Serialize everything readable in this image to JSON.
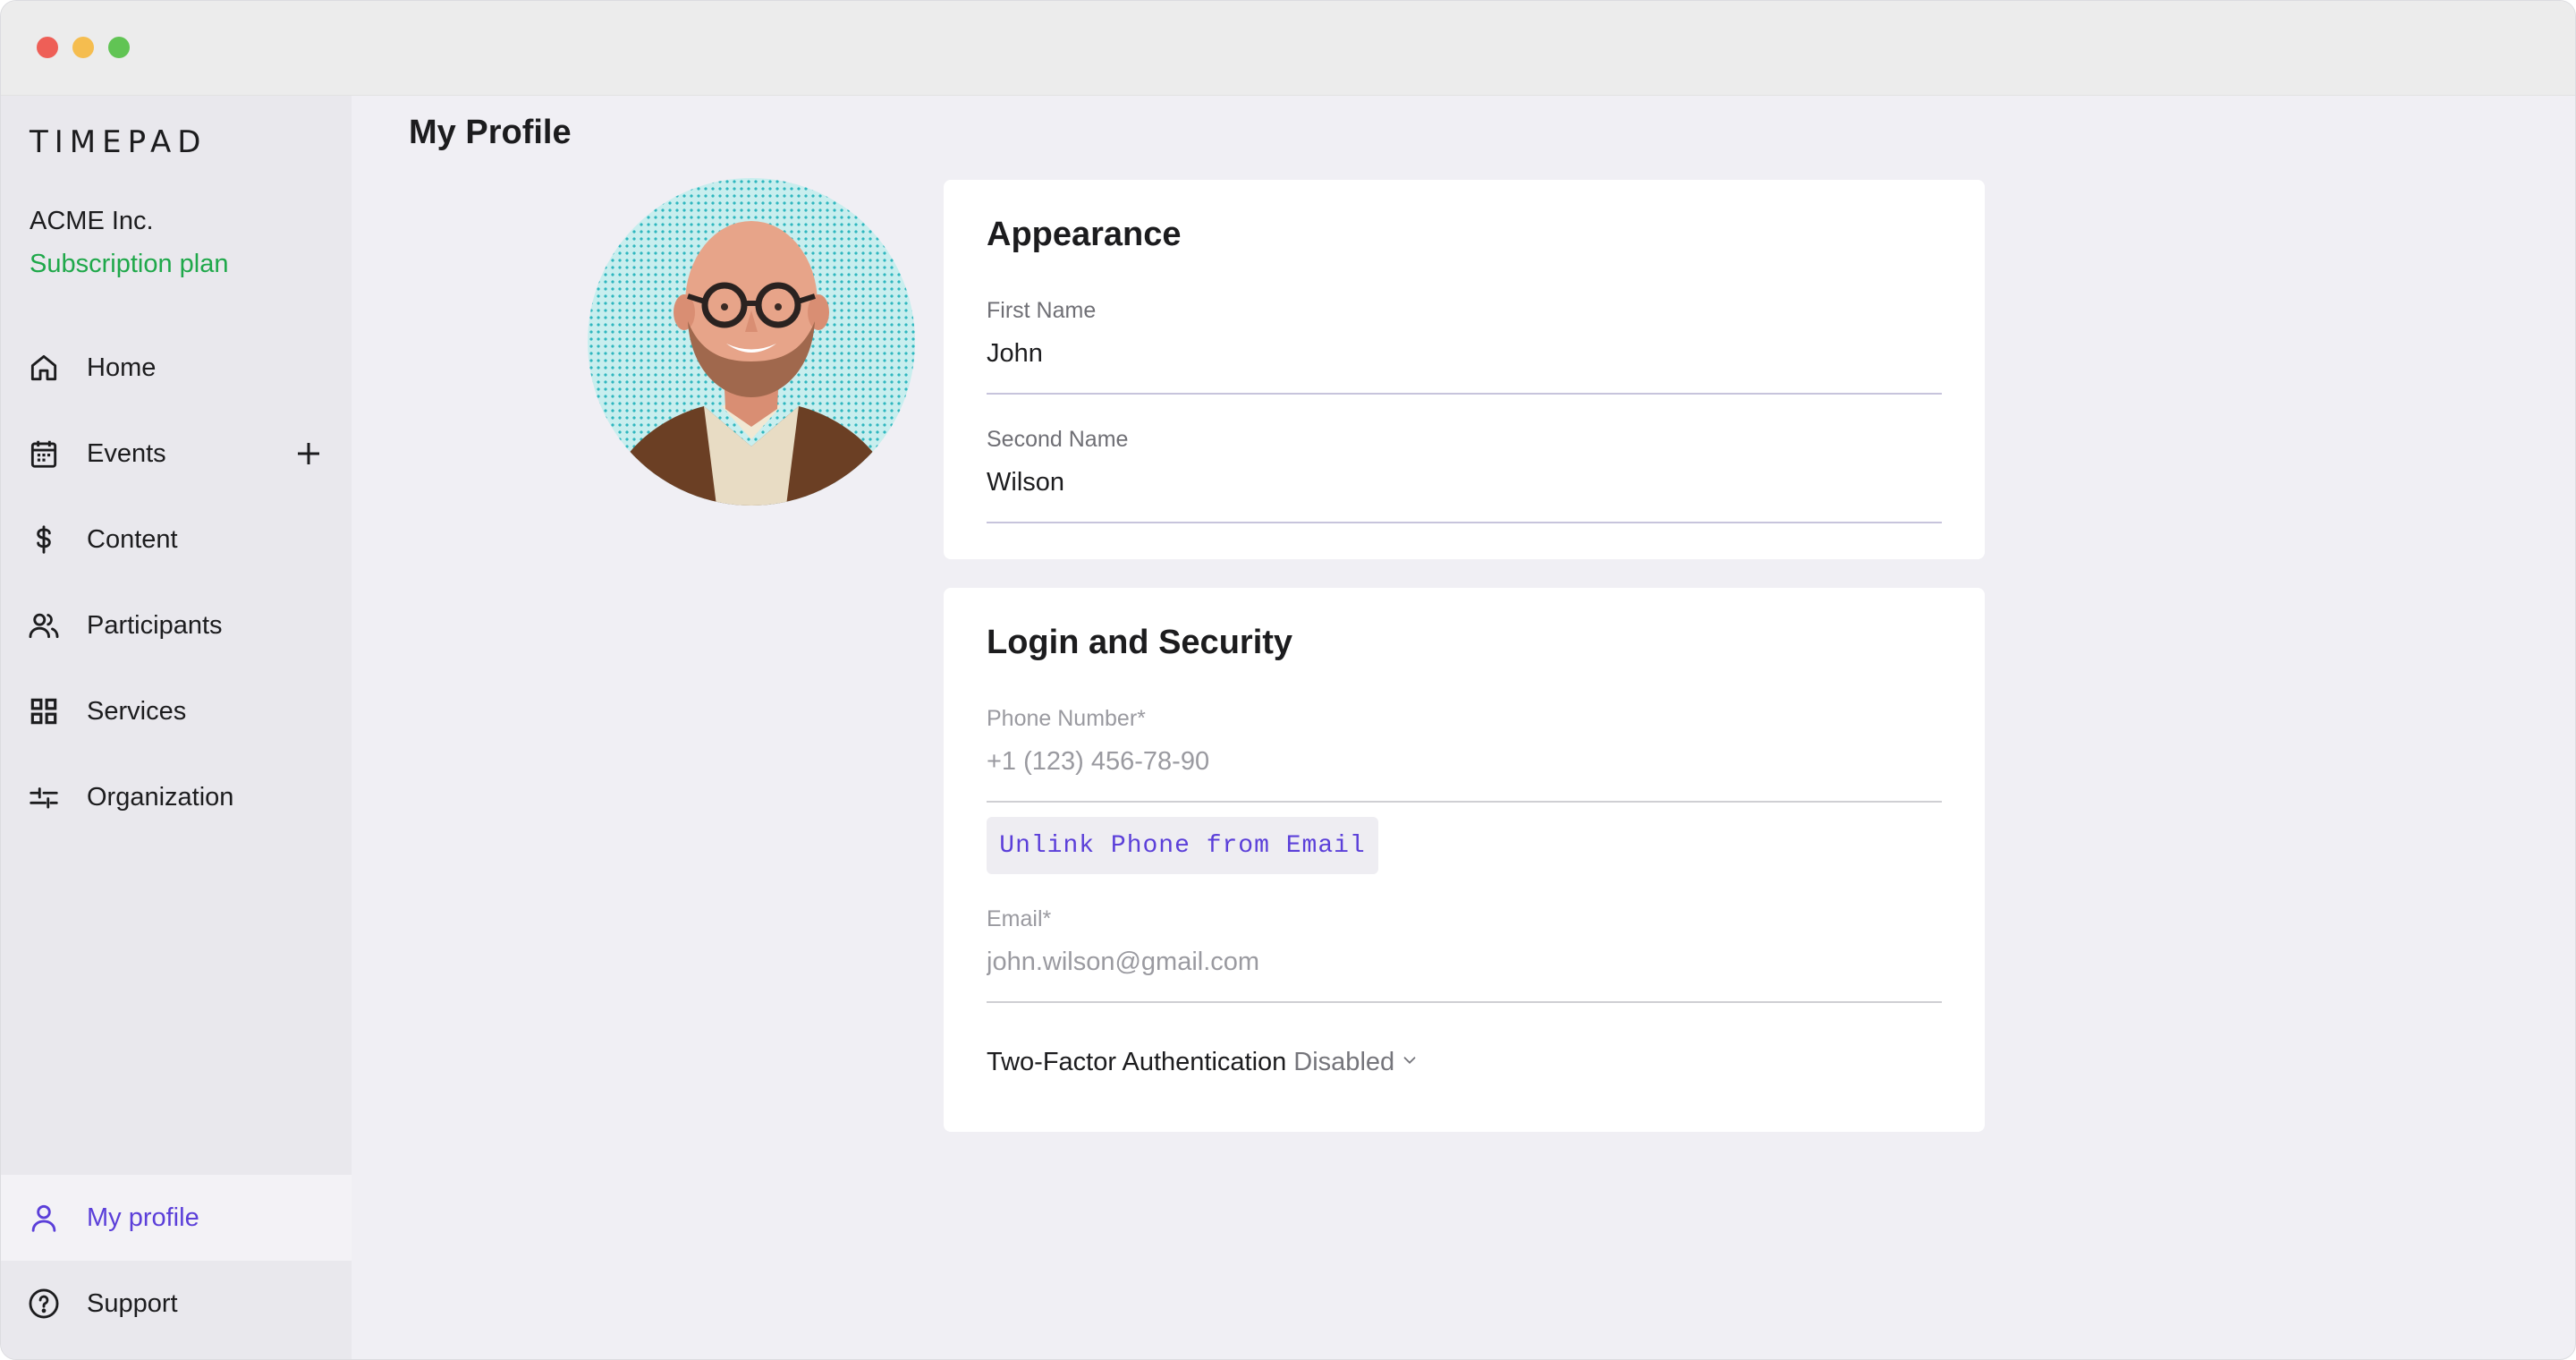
{
  "window": {
    "controls": [
      "close",
      "minimize",
      "maximize"
    ]
  },
  "sidebar": {
    "logo": "TIMEPAD",
    "org_name": "ACME Inc.",
    "plan_link": "Subscription plan",
    "items": [
      {
        "label": "Home",
        "icon": "home-icon"
      },
      {
        "label": "Events",
        "icon": "calendar-icon"
      },
      {
        "label": "Content",
        "icon": "dollar-icon"
      },
      {
        "label": "Participants",
        "icon": "users-icon"
      },
      {
        "label": "Services",
        "icon": "grid-icon"
      },
      {
        "label": "Organization",
        "icon": "sliders-icon"
      }
    ],
    "bottom_items": [
      {
        "label": "My profile",
        "icon": "user-icon",
        "active": true
      },
      {
        "label": "Support",
        "icon": "help-icon"
      }
    ]
  },
  "main": {
    "title": "My Profile",
    "appearance": {
      "title": "Appearance",
      "first_name_label": "First Name",
      "first_name": "John",
      "second_name_label": "Second Name",
      "second_name": "Wilson"
    },
    "security": {
      "title": "Login and Security",
      "phone_label": "Phone Number*",
      "phone": "+1 (123) 456-78-90",
      "unlink_button": "Unlink Phone from Email",
      "email_label": "Email*",
      "email": "john.wilson@gmail.com",
      "twofa_label": "Two-Factor Authentication",
      "twofa_status": "Disabled"
    }
  },
  "colors": {
    "accent": "#5b3fd9",
    "plan_green": "#1fa84a",
    "sidebar_bg": "#e9e8ed",
    "content_bg": "#f0eff4"
  }
}
